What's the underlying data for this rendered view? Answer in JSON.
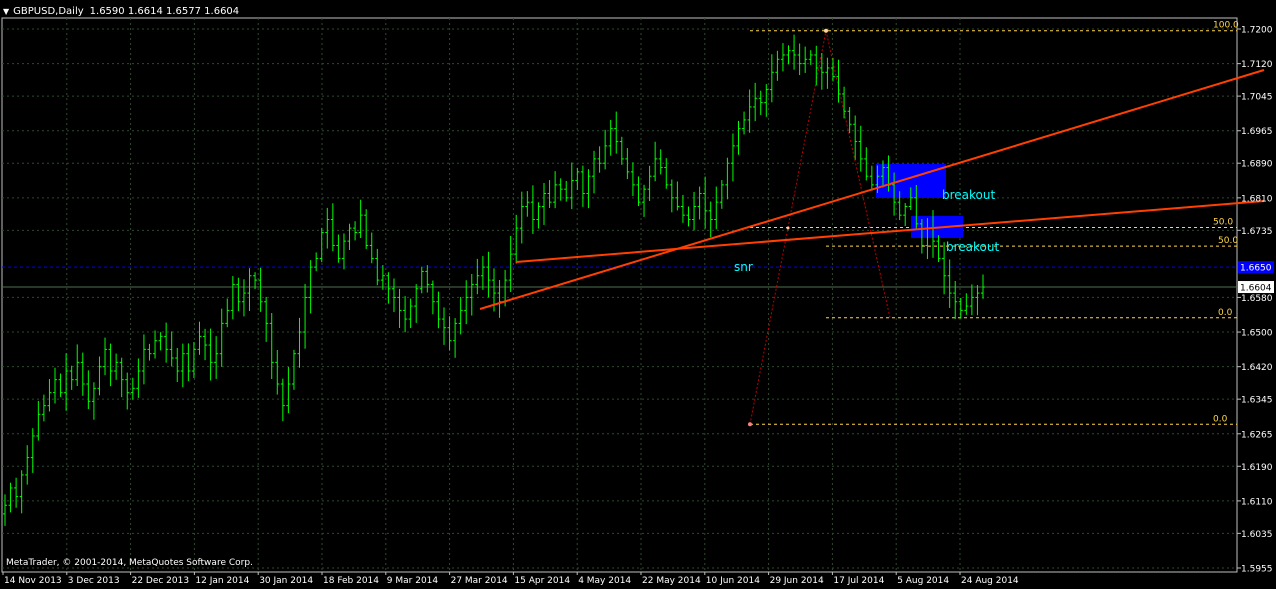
{
  "header": {
    "symbol_period": "GBPUSD,Daily",
    "ohlc": "1.6590 1.6614 1.6577 1.6604"
  },
  "copyright": "MetaTrader, © 2001-2014, MetaQuotes Software Corp.",
  "colors": {
    "background": "#000000",
    "grid": "#2e4a2e",
    "candle": "#00ff00",
    "trendline": "#ff4000",
    "fib": "#ffd84a",
    "zone": "#0000ff",
    "hline": "#0000ff",
    "label": "#00ffff"
  },
  "chart_data": {
    "type": "candlestick",
    "symbol": "GBPUSD",
    "timeframe": "Daily",
    "y_labels": [
      "1.7200",
      "1.7120",
      "1.7045",
      "1.6965",
      "1.6890",
      "1.6810",
      "1.6735",
      "1.6580",
      "1.6500",
      "1.6420",
      "1.6345",
      "1.6265",
      "1.6190",
      "1.6110",
      "1.6035",
      "1.5955"
    ],
    "ylim": [
      1.5955,
      1.72
    ],
    "x_labels": [
      "14 Nov 2013",
      "3 Dec 2013",
      "22 Dec 2013",
      "12 Jan 2014",
      "30 Jan 2014",
      "18 Feb 2014",
      "9 Mar 2014",
      "27 Mar 2014",
      "15 Apr 2014",
      "4 May 2014",
      "22 May 2014",
      "10 Jun 2014",
      "29 Jun 2014",
      "17 Jul 2014",
      "5 Aug 2014",
      "24 Aug 2014"
    ],
    "current_price_label": "1.6604",
    "hline_price_label": "1.6650",
    "closes": [
      1.61,
      1.614,
      1.612,
      1.617,
      1.621,
      1.626,
      1.631,
      1.633,
      1.636,
      1.639,
      1.636,
      1.641,
      1.639,
      1.643,
      1.638,
      1.634,
      1.637,
      1.642,
      1.646,
      1.641,
      1.643,
      1.639,
      1.636,
      1.637,
      1.641,
      1.646,
      1.645,
      1.648,
      1.649,
      1.646,
      1.644,
      1.641,
      1.645,
      1.641,
      1.646,
      1.649,
      1.647,
      1.643,
      1.645,
      1.652,
      1.655,
      1.661,
      1.657,
      1.659,
      1.663,
      1.662,
      1.657,
      1.652,
      1.643,
      1.638,
      1.633,
      1.638,
      1.645,
      1.65,
      1.658,
      1.665,
      1.667,
      1.673,
      1.676,
      1.67,
      1.667,
      1.671,
      1.674,
      1.673,
      1.677,
      1.67,
      1.667,
      1.662,
      1.663,
      1.66,
      1.658,
      1.655,
      1.653,
      1.656,
      1.66,
      1.664,
      1.661,
      1.657,
      1.653,
      1.651,
      1.648,
      1.652,
      1.655,
      1.658,
      1.661,
      1.663,
      1.665,
      1.662,
      1.659,
      1.657,
      1.662,
      1.668,
      1.674,
      1.679,
      1.68,
      1.676,
      1.679,
      1.682,
      1.68,
      1.684,
      1.683,
      1.681,
      1.685,
      1.687,
      1.682,
      1.686,
      1.69,
      1.689,
      1.693,
      1.697,
      1.694,
      1.69,
      1.687,
      1.684,
      1.68,
      1.683,
      1.686,
      1.69,
      1.688,
      1.684,
      1.681,
      1.679,
      1.677,
      1.676,
      1.679,
      1.682,
      1.678,
      1.676,
      1.68,
      1.684,
      1.689,
      1.693,
      1.697,
      1.699,
      1.702,
      1.704,
      1.703,
      1.706,
      1.71,
      1.713,
      1.714,
      1.715,
      1.714,
      1.712,
      1.713,
      1.714,
      1.711,
      1.71,
      1.711,
      1.709,
      1.705,
      1.701,
      1.698,
      1.694,
      1.69,
      1.686,
      1.684,
      1.686,
      1.688,
      1.684,
      1.68,
      1.677,
      1.679,
      1.681,
      1.675,
      1.67,
      1.674,
      1.671,
      1.667,
      1.663,
      1.659,
      1.657,
      1.655,
      1.656,
      1.658,
      1.659,
      1.6604
    ],
    "fibonacci": [
      {
        "levels": [
          "100.0",
          "50.0",
          "0.0"
        ],
        "high": 1.7196,
        "low": 1.6287
      },
      {
        "levels": [
          "50.0",
          "0.0"
        ],
        "high": 1.6864,
        "low": 1.6533
      }
    ],
    "breakout_zones": [
      {
        "label": "breakout"
      },
      {
        "label": "breakout"
      }
    ],
    "snr_label": "snr"
  }
}
